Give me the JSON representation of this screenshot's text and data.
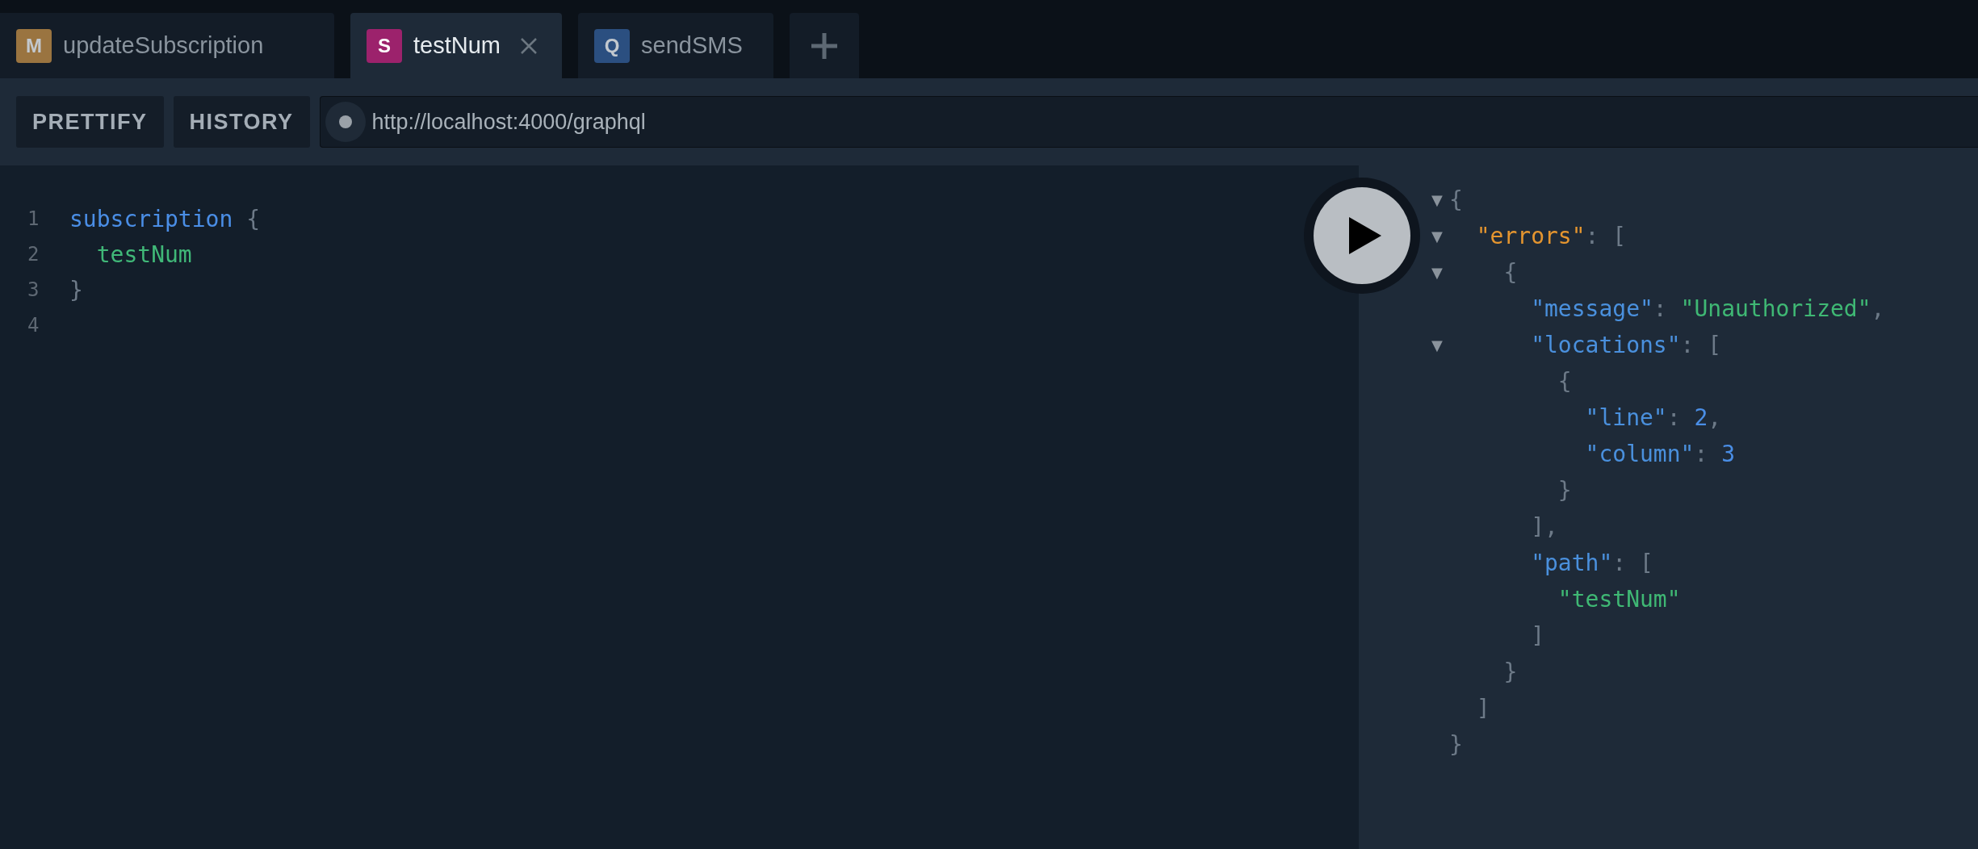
{
  "tabs": [
    {
      "badge": "M",
      "color": "#9a7440",
      "label": "updateSubscription",
      "selected": false
    },
    {
      "badge": "S",
      "color": "#9c226c",
      "label": "testNum",
      "selected": true
    },
    {
      "badge": "Q",
      "color": "#2b4f80",
      "label": "sendSMS",
      "selected": false
    }
  ],
  "toolbar": {
    "buttons": [
      "PRETTIFY",
      "HISTORY"
    ],
    "endpoint": "http://localhost:4000/graphql"
  },
  "editor": {
    "lines": [
      {
        "number": "1",
        "tokens": [
          {
            "kind": "keyword",
            "text": "subscription"
          },
          {
            "kind": "punct",
            "text": "{"
          }
        ],
        "children": [
          {
            "number": "2",
            "tokens": [
              {
                "kind": "field",
                "text": "testNum"
              }
            ]
          }
        ]
      },
      {
        "number": "3",
        "tokens": [
          {
            "kind": "punct",
            "text": "}"
          }
        ]
      },
      {
        "number": "4"
      }
    ]
  },
  "result": {
    "lines": [
      {
        "toggle": "▼",
        "tokens": [
          {
            "kind": "punct",
            "text": "{"
          }
        ],
        "children": [
          {
            "toggle": "▼",
            "tokens": [
              {
                "kind": "error-key",
                "text": "\"errors\""
              },
              {
                "kind": "punct",
                "text": ": ["
              }
            ],
            "children": [
              {
                "toggle": "▼",
                "tokens": [
                  {
                    "kind": "punct",
                    "text": "{"
                  }
                ],
                "children": [
                  {
                    "tokens": [
                      {
                        "kind": "key",
                        "text": "\"message\""
                      },
                      {
                        "kind": "punct",
                        "text": ":"
                      },
                      {
                        "kind": "string",
                        "text": "\"Unauthorized\""
                      },
                      {
                        "kind": "punct",
                        "text": ","
                      }
                    ]
                  },
                  {
                    "toggle": "▼",
                    "tokens": [
                      {
                        "kind": "key",
                        "text": "\"locations\""
                      },
                      {
                        "kind": "punct",
                        "text": ": ["
                      }
                    ],
                    "children": [
                      {
                        "tokens": [
                          {
                            "kind": "punct",
                            "text": "{"
                          }
                        ],
                        "children": [
                          {
                            "tokens": [
                              {
                                "kind": "key",
                                "text": "\"line\""
                              },
                              {
                                "kind": "punct",
                                "text": ":"
                              },
                              {
                                "kind": "number",
                                "text": "2"
                              },
                              {
                                "kind": "punct",
                                "text": ","
                              }
                            ]
                          },
                          {
                            "tokens": [
                              {
                                "kind": "key",
                                "text": "\"column\""
                              },
                              {
                                "kind": "punct",
                                "text": ":"
                              },
                              {
                                "kind": "number",
                                "text": "3"
                              }
                            ]
                          }
                        ]
                      },
                      {
                        "tokens": [
                          {
                            "kind": "punct",
                            "text": "}"
                          }
                        ]
                      }
                    ]
                  },
                  {
                    "tokens": [
                      {
                        "kind": "punct",
                        "text": "],"
                      }
                    ]
                  },
                  {
                    "tokens": [
                      {
                        "kind": "key",
                        "text": "\"path\""
                      },
                      {
                        "kind": "punct",
                        "text": ": ["
                      }
                    ],
                    "children": [
                      {
                        "tokens": [
                          {
                            "kind": "string",
                            "text": "\"testNum\""
                          }
                        ]
                      }
                    ]
                  },
                  {
                    "tokens": [
                      {
                        "kind": "punct",
                        "text": "]"
                      }
                    ]
                  }
                ]
              },
              {
                "tokens": [
                  {
                    "kind": "punct",
                    "text": "}"
                  }
                ]
              }
            ]
          },
          {
            "tokens": [
              {
                "kind": "punct",
                "text": "]"
              }
            ]
          }
        ]
      },
      {
        "tokens": [
          {
            "kind": "punct",
            "text": "}"
          }
        ]
      }
    ]
  }
}
